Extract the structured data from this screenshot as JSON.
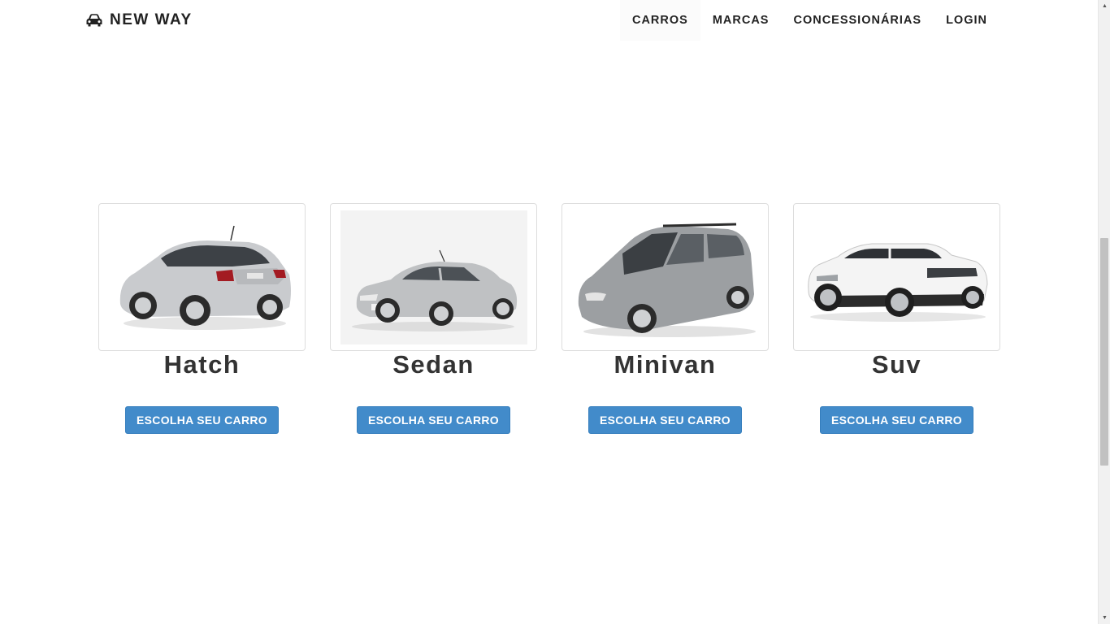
{
  "brand": {
    "name": "NEW WAY",
    "icon": "car-icon"
  },
  "nav": {
    "items": [
      {
        "label": "CARROS",
        "active": true
      },
      {
        "label": "MARCAS",
        "active": false
      },
      {
        "label": "CONCESSIONÁRIAS",
        "active": false
      },
      {
        "label": "LOGIN",
        "active": false
      }
    ]
  },
  "cards": [
    {
      "title": "Hatch",
      "button": "ESCOLHA SEU CARRO",
      "image": "hatch-car-image",
      "color": "#c9cbce"
    },
    {
      "title": "Sedan",
      "button": "ESCOLHA SEU CARRO",
      "image": "sedan-car-image",
      "color": "#bfc1c3"
    },
    {
      "title": "Minivan",
      "button": "ESCOLHA SEU CARRO",
      "image": "minivan-car-image",
      "color": "#9c9fa2"
    },
    {
      "title": "Suv",
      "button": "ESCOLHA SEU CARRO",
      "image": "suv-car-image",
      "color": "#f4f4f4"
    }
  ],
  "colors": {
    "button": "#428bca",
    "text": "#333333"
  }
}
